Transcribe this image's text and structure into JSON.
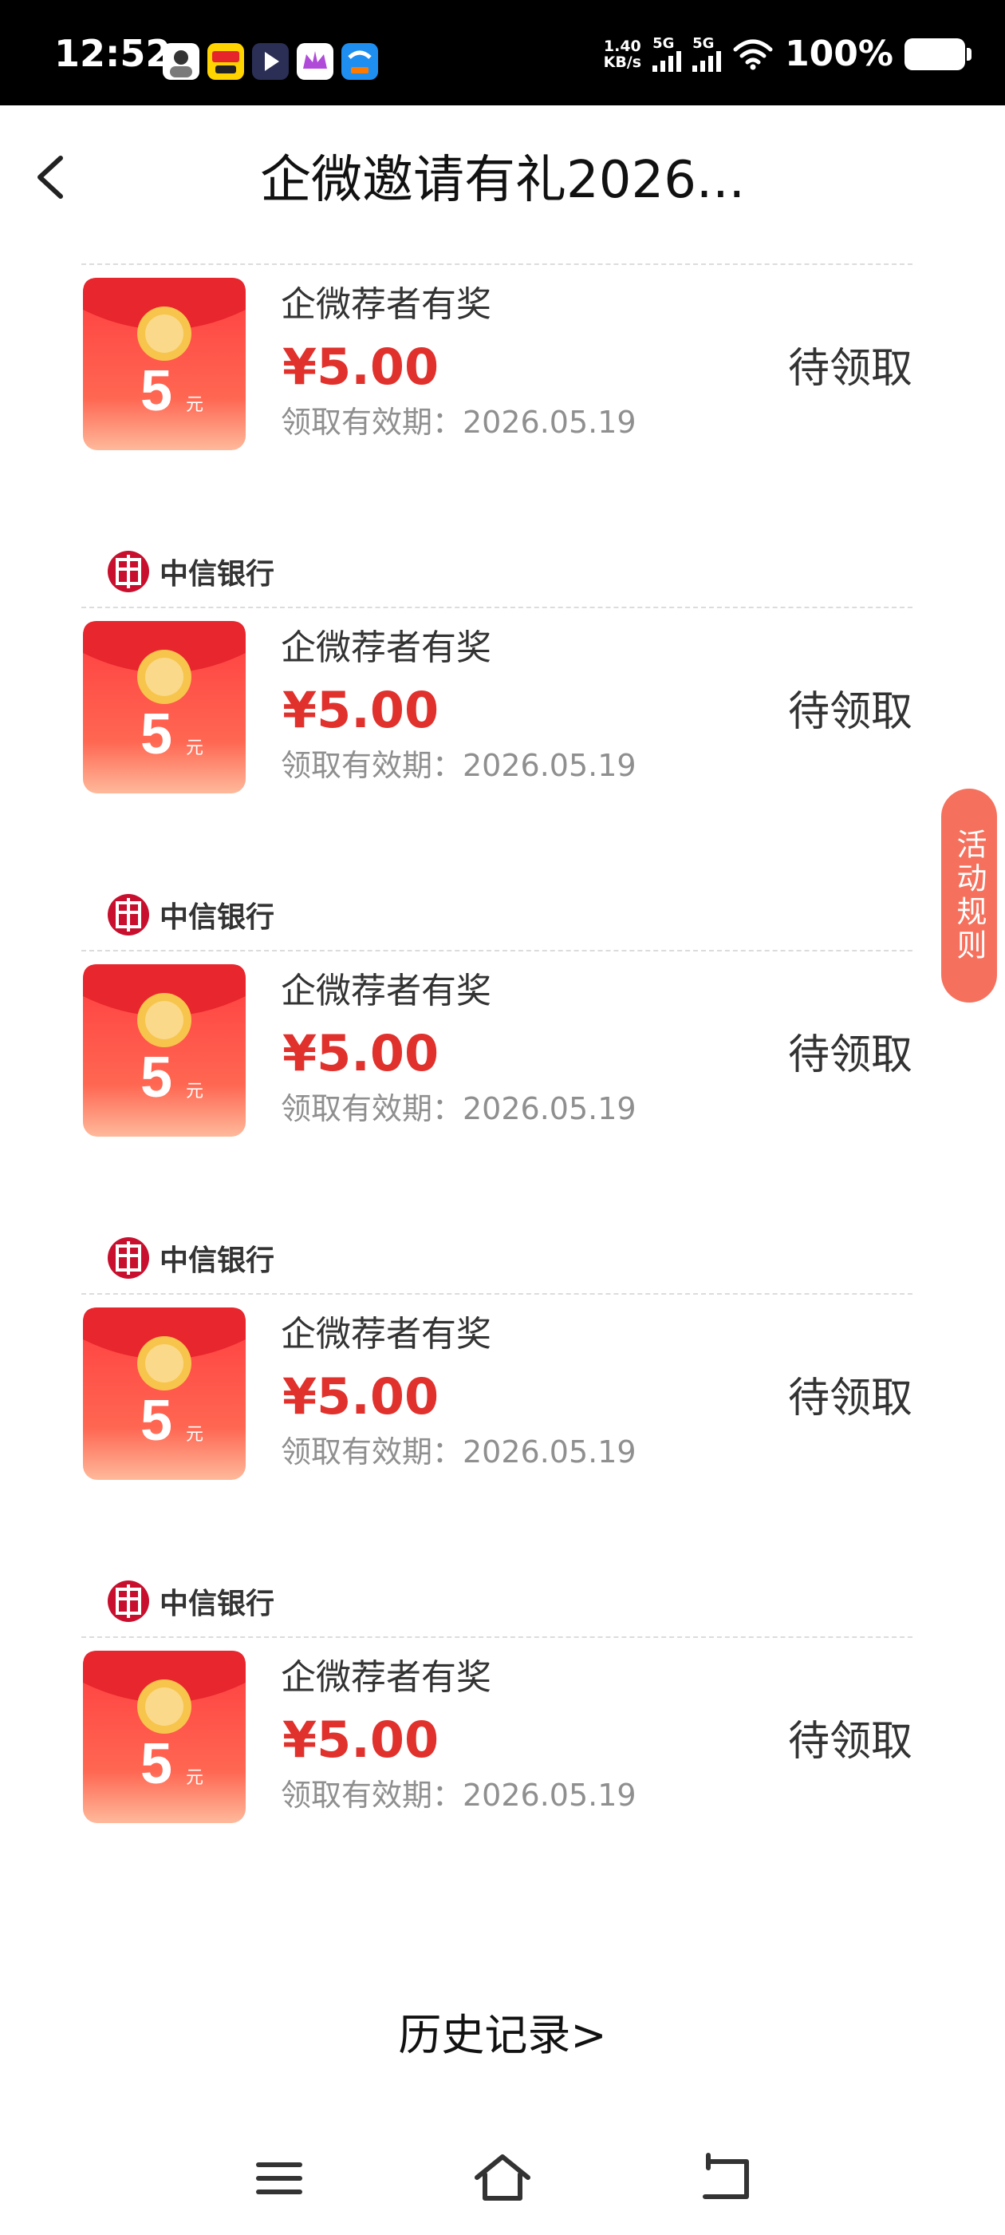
{
  "status_bar": {
    "time": "12:52",
    "net_speed_value": "1.40",
    "net_speed_unit": "KB/s",
    "signal1_label": "5G",
    "signal2_label": "5G",
    "battery": "100%"
  },
  "header": {
    "title": "企微邀请有礼2026..."
  },
  "cards": [
    {
      "bank": "",
      "reward_name": "企微荐者有奖",
      "amount": "¥5.00",
      "expiry": "领取有效期：2026.05.19",
      "status": "待领取",
      "envelope_value": "5",
      "envelope_unit": "元"
    },
    {
      "bank": "中信银行",
      "reward_name": "企微荐者有奖",
      "amount": "¥5.00",
      "expiry": "领取有效期：2026.05.19",
      "status": "待领取",
      "envelope_value": "5",
      "envelope_unit": "元"
    },
    {
      "bank": "中信银行",
      "reward_name": "企微荐者有奖",
      "amount": "¥5.00",
      "expiry": "领取有效期：2026.05.19",
      "status": "待领取",
      "envelope_value": "5",
      "envelope_unit": "元"
    },
    {
      "bank": "中信银行",
      "reward_name": "企微荐者有奖",
      "amount": "¥5.00",
      "expiry": "领取有效期：2026.05.19",
      "status": "待领取",
      "envelope_value": "5",
      "envelope_unit": "元"
    },
    {
      "bank": "中信银行",
      "reward_name": "企微荐者有奖",
      "amount": "¥5.00",
      "expiry": "领取有效期：2026.05.19",
      "status": "待领取",
      "envelope_value": "5",
      "envelope_unit": "元"
    }
  ],
  "rules_tab": "活动规则",
  "history_link": "历史记录>",
  "colors": {
    "accent_red": "#e0312d",
    "rules_tab": "#f5715d",
    "envelope_top": "#ff4a48",
    "envelope_bottom": "#ffb79a"
  }
}
